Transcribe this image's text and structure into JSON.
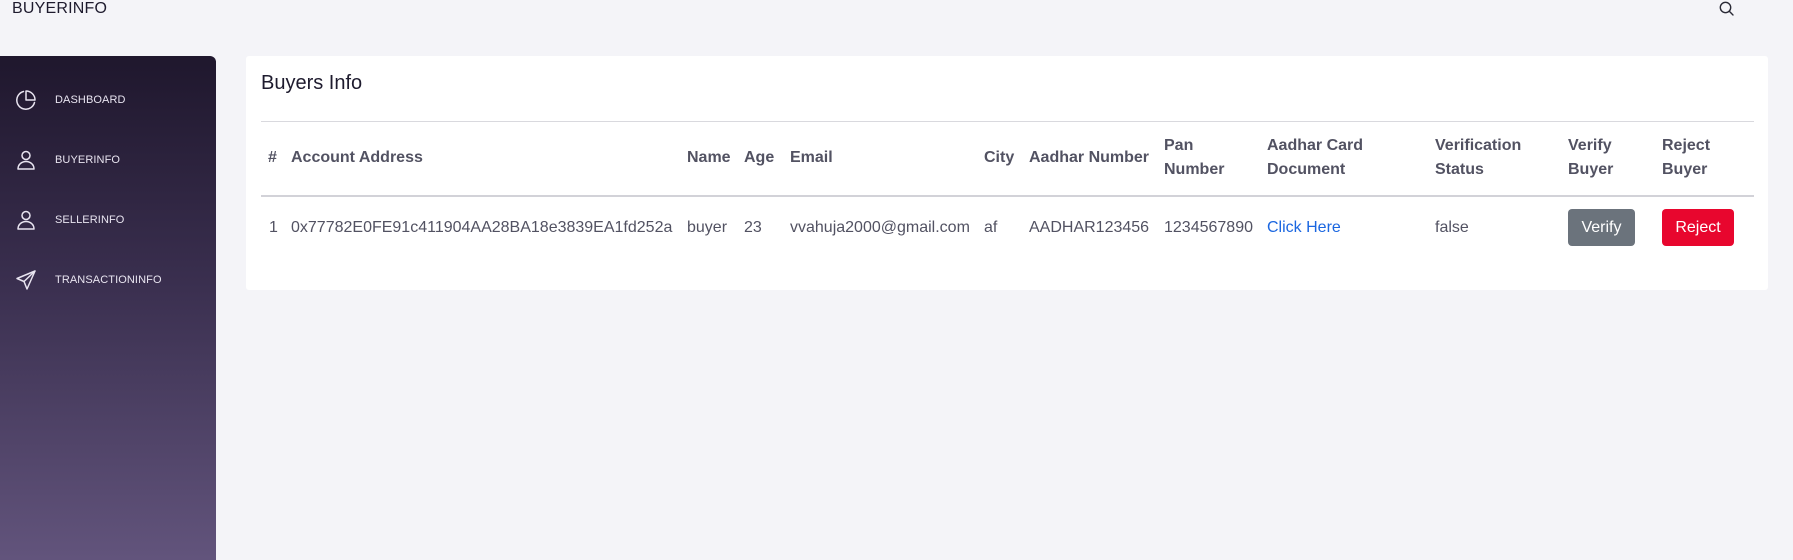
{
  "header": {
    "title": "BUYERINFO",
    "search_icon": "search-icon"
  },
  "sidebar": {
    "items": [
      {
        "label": "DASHBOARD",
        "icon": "pie-chart-icon"
      },
      {
        "label": "BUYERINFO",
        "icon": "user-icon"
      },
      {
        "label": "SELLERINFO",
        "icon": "user-icon"
      },
      {
        "label": "TRANSACTIONINFO",
        "icon": "send-icon"
      }
    ]
  },
  "card": {
    "title": "Buyers Info",
    "columns": [
      "#",
      "Account Address",
      "Name",
      "Age",
      "Email",
      "City",
      "Aadhar Number",
      [
        "Pan",
        "Number"
      ],
      [
        "Aadhar Card",
        "Document"
      ],
      [
        "Verification",
        "Status"
      ],
      [
        "Verify",
        "Buyer"
      ],
      [
        "Reject",
        "Buyer"
      ]
    ],
    "rows": [
      {
        "index": "1",
        "account_address": "0x77782E0FE91c411904AA28BA18e3839EA1fd252a",
        "name": "buyer",
        "age": "23",
        "email": "vvahuja2000@gmail.com",
        "city": "af",
        "aadhar_number": "AADHAR123456",
        "pan_number": "1234567890",
        "document_link": "Click Here",
        "verification_status": "false",
        "verify_label": "Verify",
        "reject_label": "Reject"
      }
    ]
  },
  "colors": {
    "sidebar_top": "#1f172d",
    "sidebar_bottom": "#62547c",
    "verify_button": "#6b737c",
    "reject_button": "#e8062e",
    "link": "#1a66e0"
  }
}
